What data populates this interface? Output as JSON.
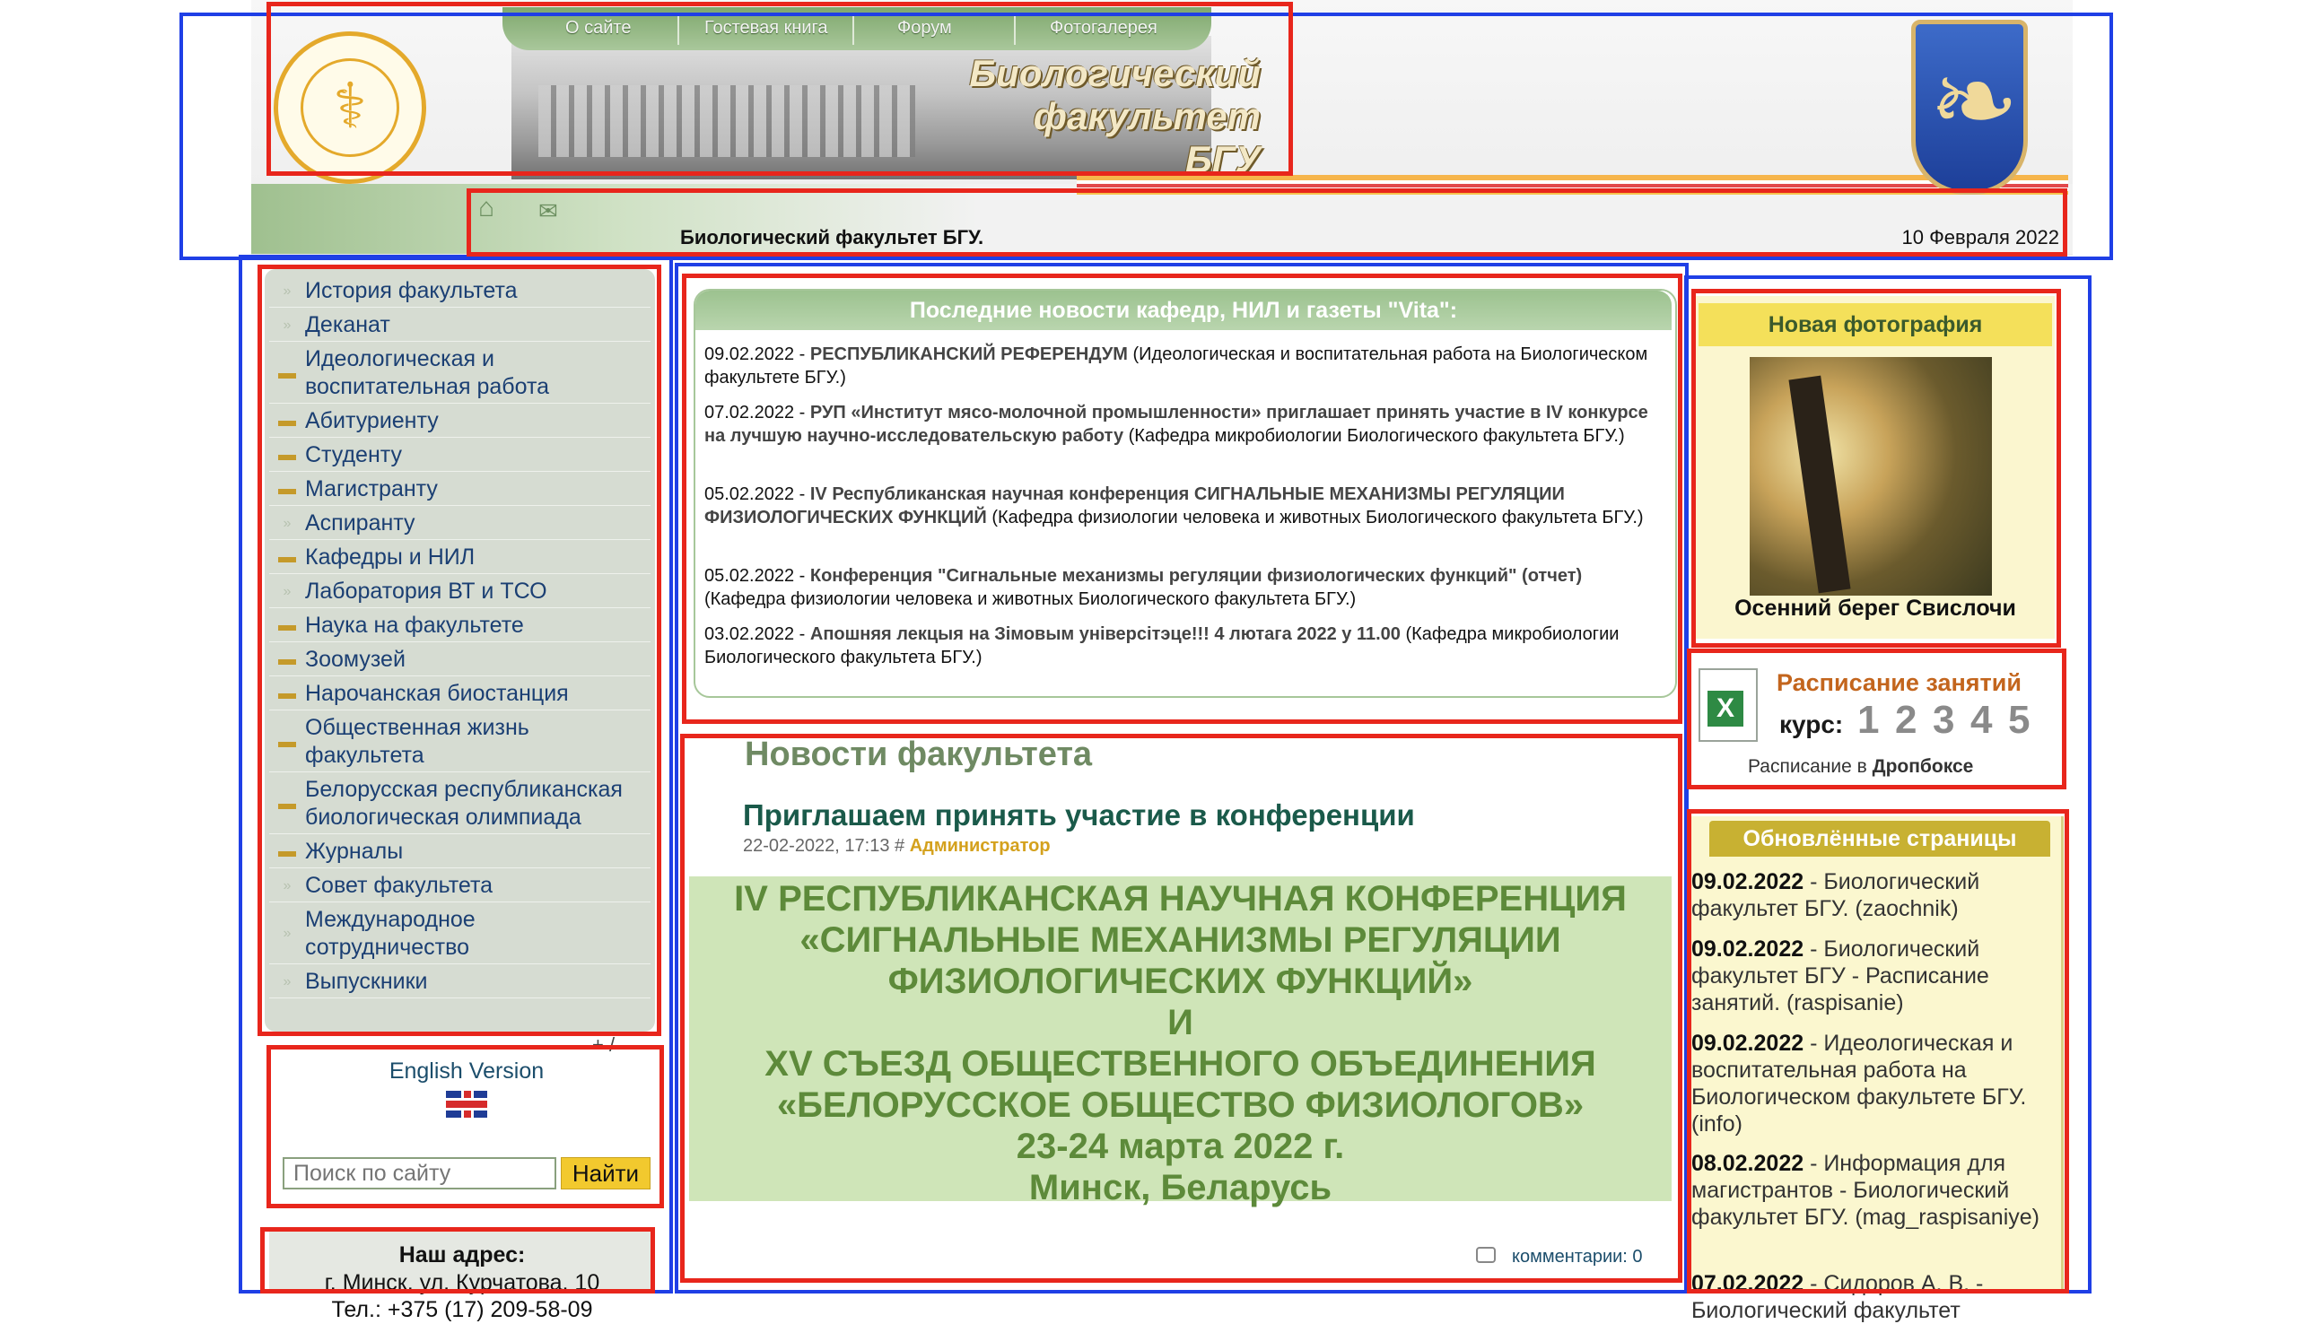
{
  "header": {
    "nav": [
      "О сайте",
      "Гостевая книга",
      "Форум",
      "Фотогалерея"
    ],
    "site_title_line1": "Биологический",
    "site_title_line2": "факультет",
    "site_title_line3": "БГУ",
    "caption": "Биологический факультет БГУ.",
    "date": "10 Февраля 2022",
    "logo_text": "БГУ"
  },
  "menu": [
    {
      "label": "История факультета",
      "icon": "arrow-icon"
    },
    {
      "label": "Деканат",
      "icon": "arrow-icon"
    },
    {
      "label": "Идеологическая и воспитательная работа",
      "icon": "folder-icon"
    },
    {
      "label": "Абитуриенту",
      "icon": "folder-icon"
    },
    {
      "label": "Студенту",
      "icon": "folder-icon"
    },
    {
      "label": "Магистранту",
      "icon": "folder-icon"
    },
    {
      "label": "Аспиранту",
      "icon": "arrow-icon"
    },
    {
      "label": "Кафедры и НИЛ",
      "icon": "folder-icon"
    },
    {
      "label": "Лаборатория ВТ и ТСО",
      "icon": "arrow-icon"
    },
    {
      "label": "Наука на факультете",
      "icon": "folder-icon"
    },
    {
      "label": "Зоомузей",
      "icon": "folder-icon"
    },
    {
      "label": "Нарочанская биостанция",
      "icon": "folder-icon"
    },
    {
      "label": "Общественная жизнь факультета",
      "icon": "folder-icon"
    },
    {
      "label": "Белорусская республиканская биологическая олимпиада",
      "icon": "folder-icon"
    },
    {
      "label": "Журналы",
      "icon": "folder-icon"
    },
    {
      "label": "Совет факультета",
      "icon": "arrow-icon"
    },
    {
      "label": "Международное сотрудничество",
      "icon": "arrow-icon"
    },
    {
      "label": "Выпускники",
      "icon": "arrow-icon"
    }
  ],
  "sidebar": {
    "misc": "+ /",
    "english": "English Version",
    "search_placeholder": "Поиск по сайту",
    "search_button": "Найти",
    "address_title": "Наш адрес:",
    "address_line1": "г. Минск, ул. Курчатова, 10",
    "address_line2": "Тел.: +375 (17) 209-58-09"
  },
  "latest_news": {
    "title": "Последние новости кафедр, НИЛ и газеты \"Vita\":",
    "items": [
      {
        "date": "09.02.2022 - ",
        "link": "РЕСПУБЛИКАНСКИЙ РЕФЕРЕНДУМ",
        "rest": " (Идеологическая и воспитательная работа на Биологическом факультете БГУ.)"
      },
      {
        "date": "07.02.2022 - ",
        "link": "РУП «Институт мясо-молочной промышленности» приглашает принять участие в IV конкурсе на лучшую научно-исследовательскую работу",
        "rest": " (Кафедра микробиологии Биологического факультета БГУ.)"
      },
      {
        "date": "05.02.2022 - ",
        "link": "IV Республиканская научная конференция СИГНАЛЬНЫЕ МЕХАНИЗМЫ РЕГУЛЯЦИИ ФИЗИОЛОГИЧЕСКИХ ФУНКЦИЙ",
        "rest": " (Кафедра физиологии человека и животных Биологического факультета БГУ.)"
      },
      {
        "date": "05.02.2022 - ",
        "link": "Конференция \"Сигнальные механизмы регуляции физиологических функций\" (отчет)",
        "rest": " (Кафедра физиологии человека и животных Биологического факультета БГУ.)"
      },
      {
        "date": "03.02.2022 - ",
        "link": "Апошняя лекцыя на Зімовым універсітэце!!! 4 лютага 2022 у 11.00",
        "rest": " (Кафедра микробиологии Биологического факультета БГУ.)"
      }
    ]
  },
  "faculty_news": {
    "title": "Новости факультета",
    "post_title": "Приглашаем принять участие в конференции",
    "post_meta": "22-02-2022, 17:13 # ",
    "post_author": "Администратор",
    "banner_lines": [
      "IV РЕСПУБЛИКАНСКАЯ НАУЧНАЯ КОНФЕРЕНЦИЯ",
      "«СИГНАЛЬНЫЕ МЕХАНИЗМЫ РЕГУЛЯЦИИ",
      "ФИЗИОЛОГИЧЕСКИХ ФУНКЦИЙ»",
      "И",
      "XV СЪЕЗД ОБЩЕСТВЕННОГО ОБЪЕДИНЕНИЯ",
      "«БЕЛОРУССКОЕ ОБЩЕСТВО ФИЗИОЛОГОВ»",
      "23-24 марта 2022 г.",
      "Минск, Беларусь"
    ],
    "comments_label": "комментарии",
    "comments_count": ": 0"
  },
  "right": {
    "photo_title": "Новая фотография",
    "photo_caption": "Осенний берег Свислочи",
    "schedule_title": "Расписание занятий",
    "kurs_label": "курс:",
    "kurs_numbers": [
      "1",
      "2",
      "3",
      "4",
      "5"
    ],
    "dropbox_prefix": "Расписание в ",
    "dropbox_word": "Дропбоксе",
    "updated_title": "Обновлённые страницы",
    "updated": [
      {
        "date": "09.02.2022",
        "text": " - Биологический факультет БГУ. (zaochnik)"
      },
      {
        "date": "09.02.2022",
        "text": " - Биологический факультет БГУ - Расписание занятий. (raspisanie)"
      },
      {
        "date": "09.02.2022",
        "text": " - Идеологическая и воспитательная работа на Биологическом факультете БГУ. (info)"
      },
      {
        "date": "08.02.2022",
        "text": " - Информация для магистрантов - Биологический факультет БГУ. (mag_raspisaniye)"
      },
      {
        "date": "07.02.2022",
        "text": " - Сидоров А. В. - Биологический факультет"
      }
    ]
  },
  "colors": {
    "annotation_blue": "#1f3fe6",
    "annotation_red": "#e8261c",
    "menu_link": "#1b3f73",
    "green_header": "#9cc28f"
  }
}
